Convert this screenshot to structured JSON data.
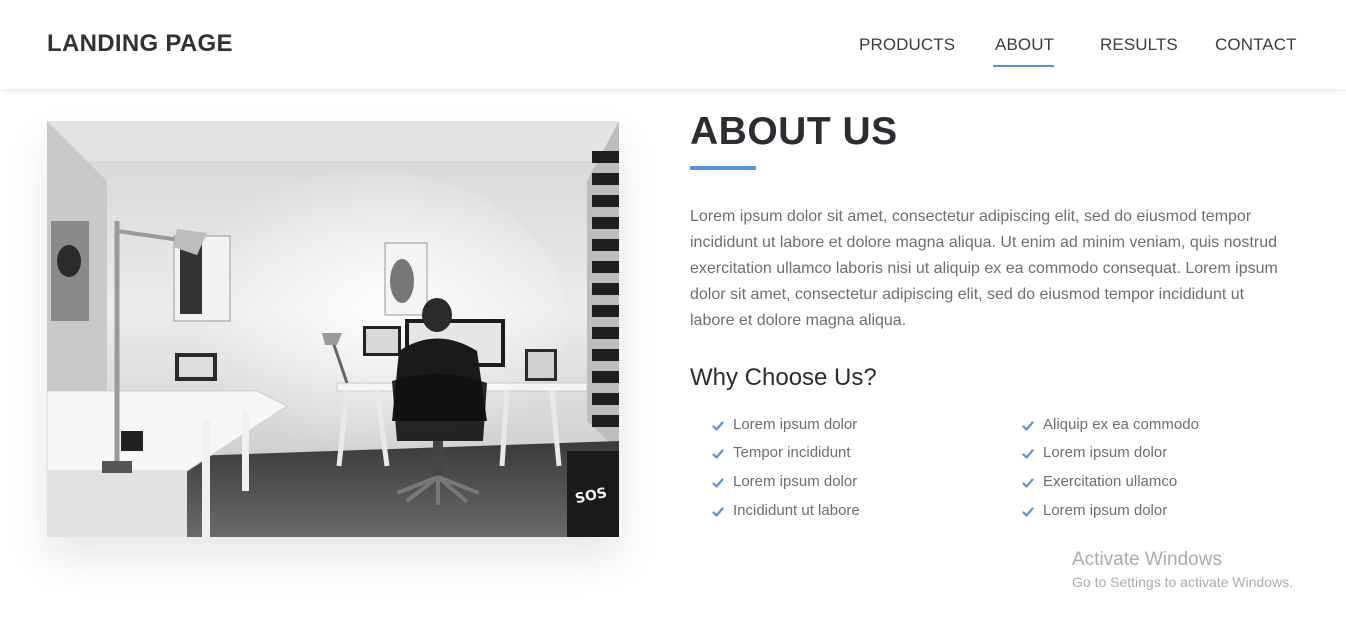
{
  "header": {
    "brand": "LANDING PAGE",
    "nav": [
      {
        "label": "PRODUCTS"
      },
      {
        "label": "ABOUT"
      },
      {
        "label": "RESULTS"
      },
      {
        "label": "CONTACT"
      }
    ],
    "active_nav": "ABOUT"
  },
  "about": {
    "title": "ABOUT US",
    "paragraph": "Lorem ipsum dolor sit amet, consectetur adipiscing elit, sed do eiusmod tempor incididunt ut labore et dolore magna aliqua. Ut enim ad minim veniam, quis nostrud exercitation ullamco laboris nisi ut aliquip ex ea commodo consequat. Lorem ipsum dolor sit amet, consectetur adipiscing elit, sed do eiusmod tempor incididunt ut labore et dolore magna aliqua.",
    "why_title": "Why Choose Us?",
    "features_left": [
      "Lorem ipsum dolor",
      "Tempor incididunt",
      "Lorem ipsum dolor",
      "Incididunt ut labore"
    ],
    "features_right": [
      "Aliquip ex ea commodo",
      "Lorem ipsum dolor",
      "Exercitation ullamco",
      "Lorem ipsum dolor"
    ],
    "check_icon": "check-icon"
  },
  "photo": {
    "description_icon": "office-photo"
  },
  "watermark": {
    "title": "Activate Windows",
    "subtitle": "Go to Settings to activate Windows."
  },
  "colors": {
    "accent": "#5b8fe0",
    "heading": "#2a2d31",
    "body_text": "#6b6f74"
  }
}
